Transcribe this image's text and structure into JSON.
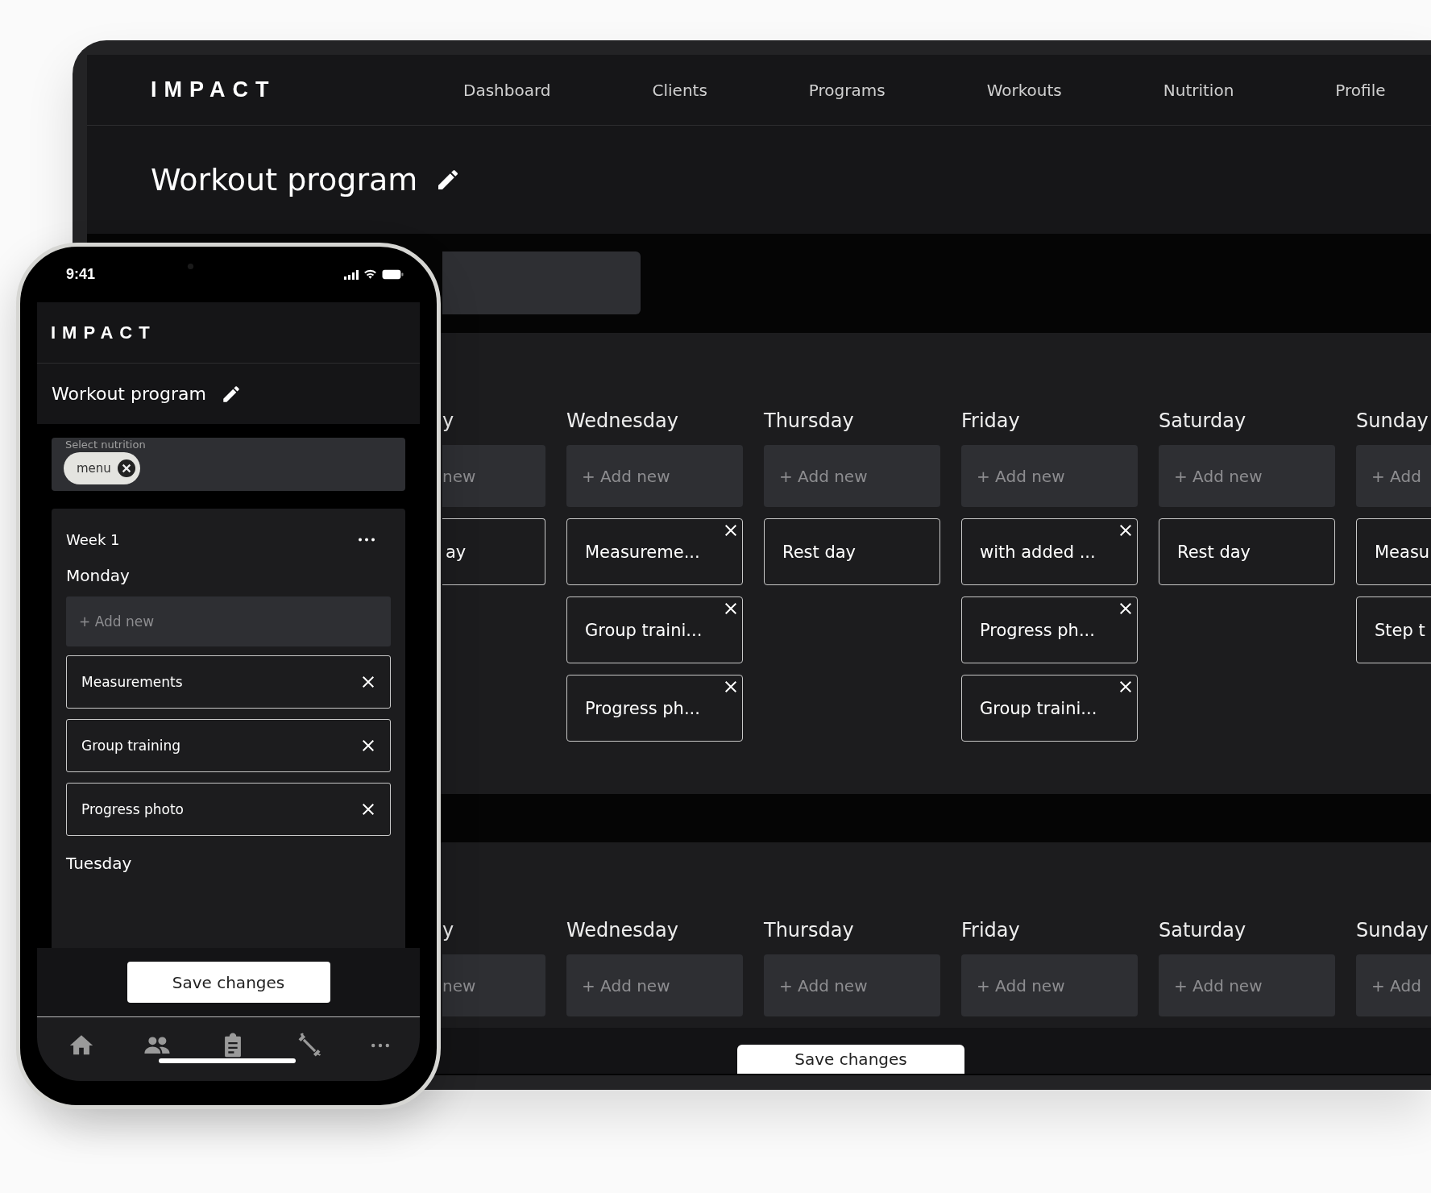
{
  "desktop": {
    "logo": "IMPACT",
    "nav": [
      "Dashboard",
      "Clients",
      "Programs",
      "Workouts",
      "Nutrition",
      "Profile"
    ],
    "title": "Workout program",
    "weeks": [
      {
        "days": [
          {
            "kind": "cut_left",
            "name": "y",
            "add": "new",
            "items": [
              {
                "label": "ay",
                "removable": false
              }
            ]
          },
          {
            "kind": "day",
            "name": "Wednesday",
            "add": "+ Add new",
            "items": [
              {
                "label": "Measureme...",
                "removable": true
              },
              {
                "label": "Group traini...",
                "removable": true
              },
              {
                "label": "Progress ph...",
                "removable": true
              }
            ]
          },
          {
            "kind": "day",
            "name": "Thursday",
            "add": "+ Add new",
            "items": [
              {
                "label": "Rest day",
                "removable": false
              }
            ]
          },
          {
            "kind": "day",
            "name": "Friday",
            "add": "+ Add new",
            "items": [
              {
                "label": "with added ...",
                "removable": true
              },
              {
                "label": "Progress ph...",
                "removable": true
              },
              {
                "label": "Group traini...",
                "removable": true
              }
            ]
          },
          {
            "kind": "day",
            "name": "Saturday",
            "add": "+ Add new",
            "items": [
              {
                "label": "Rest day",
                "removable": false
              }
            ]
          },
          {
            "kind": "day",
            "name": "Sunday",
            "add": "+ Add",
            "items": [
              {
                "label": "Measu",
                "removable": false
              },
              {
                "label": "Step t",
                "removable": false
              }
            ]
          }
        ]
      },
      {
        "days": [
          {
            "kind": "cut_left",
            "name": "y",
            "add": "new"
          },
          {
            "kind": "day",
            "name": "Wednesday",
            "add": "+ Add new"
          },
          {
            "kind": "day",
            "name": "Thursday",
            "add": "+ Add new"
          },
          {
            "kind": "day",
            "name": "Friday",
            "add": "+ Add new"
          },
          {
            "kind": "day",
            "name": "Saturday",
            "add": "+ Add new"
          },
          {
            "kind": "day",
            "name": "Sunday",
            "add": "+ Add"
          }
        ]
      }
    ],
    "save_button": "Save changes"
  },
  "phone": {
    "time": "9:41",
    "logo": "IMPACT",
    "title": "Workout program",
    "nutrition_field": {
      "label": "Select nutrition",
      "chips": [
        "menu"
      ]
    },
    "week": {
      "name": "Week 1",
      "days": [
        {
          "name": "Monday",
          "add": "+ Add new",
          "items": [
            {
              "label": "Measurements",
              "removable": true
            },
            {
              "label": "Group training",
              "removable": true
            },
            {
              "label": "Progress photo",
              "removable": true
            }
          ]
        },
        {
          "name": "Tuesday"
        }
      ]
    },
    "save_button": "Save changes"
  }
}
